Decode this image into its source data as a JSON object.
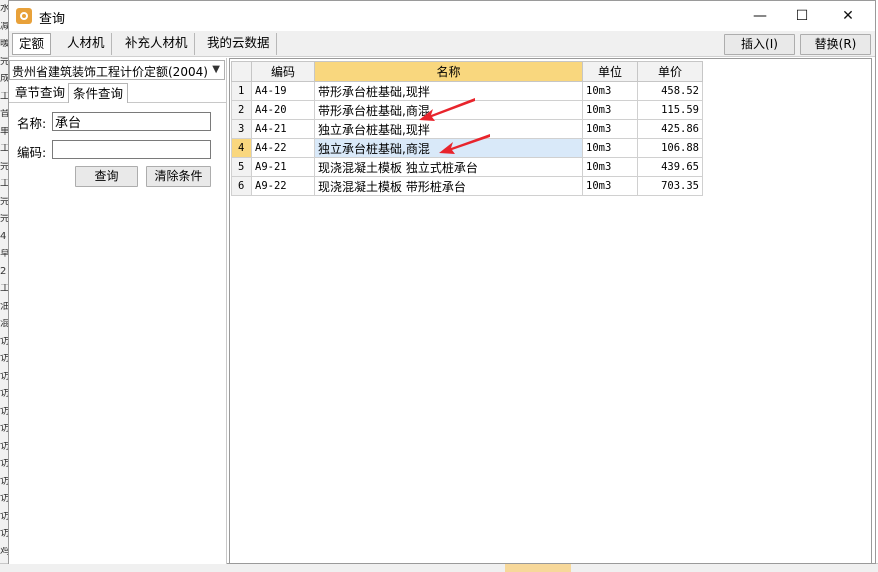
{
  "background": {
    "left_strip_chars": [
      "水",
      "减",
      "暖",
      "完",
      "成",
      "工",
      "音",
      "单",
      "工",
      "完",
      "工",
      "完",
      "完",
      "4",
      "草",
      "2",
      "工",
      "油",
      "混",
      "访",
      "访",
      "访",
      "访",
      "访",
      "访",
      "访",
      "访",
      "访",
      "访",
      "访",
      "访",
      "鸡"
    ]
  },
  "window": {
    "title": "查询",
    "minimize_glyph": "—",
    "maximize_glyph": "☐",
    "close_glyph": "✕"
  },
  "tabs": [
    {
      "label": "定额",
      "active": true
    },
    {
      "label": "人材机",
      "active": false
    },
    {
      "label": "补充人材机",
      "active": false
    },
    {
      "label": "我的云数据",
      "active": false
    }
  ],
  "toolbar": {
    "insert_label": "插入(I)",
    "replace_label": "替换(R)"
  },
  "left_panel": {
    "quota_library": "贵州省建筑装饰工程计价定额(2004)",
    "subtabs": [
      {
        "label": "章节查询",
        "active": false
      },
      {
        "label": "条件查询",
        "active": true
      }
    ],
    "name_label": "名称:",
    "name_value": "承台",
    "code_label": "编码:",
    "code_value": "",
    "search_button": "查询",
    "clear_button": "清除条件"
  },
  "grid": {
    "columns": [
      "编码",
      "名称",
      "单位",
      "单价"
    ],
    "selected_row": 4,
    "rows": [
      {
        "no": "1",
        "code": "A4-19",
        "name": "带形承台桩基础,现拌",
        "unit": "10m3",
        "price": "458.52"
      },
      {
        "no": "2",
        "code": "A4-20",
        "name": "带形承台桩基础,商混",
        "unit": "10m3",
        "price": "115.59"
      },
      {
        "no": "3",
        "code": "A4-21",
        "name": "独立承台桩基础,现拌",
        "unit": "10m3",
        "price": "425.86"
      },
      {
        "no": "4",
        "code": "A4-22",
        "name": "独立承台桩基础,商混",
        "unit": "10m3",
        "price": "106.88"
      },
      {
        "no": "5",
        "code": "A9-21",
        "name": "现浇混凝土模板 独立式桩承台",
        "unit": "10m3",
        "price": "439.65"
      },
      {
        "no": "6",
        "code": "A9-22",
        "name": "现浇混凝土模板 带形桩承台",
        "unit": "10m3",
        "price": "703.35"
      }
    ]
  },
  "colors": {
    "header_highlight": "#f9d77e",
    "selected_cell": "#d9e9f9",
    "annotation_arrow": "#e8242c"
  }
}
